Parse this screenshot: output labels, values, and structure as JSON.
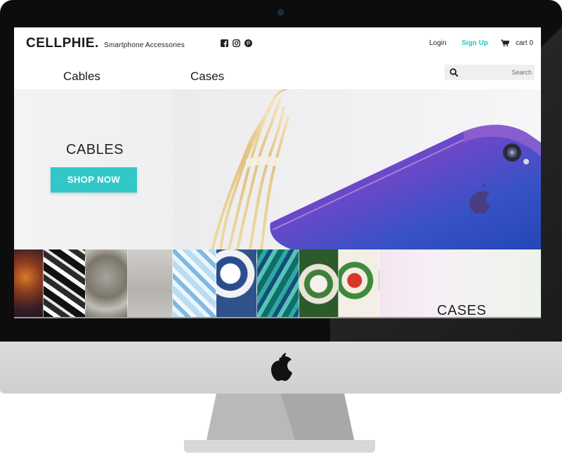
{
  "brand": {
    "logo": "CELLPHIE.",
    "tagline": "Smartphone Accessories"
  },
  "social_icons": [
    "facebook-icon",
    "instagram-icon",
    "pinterest-icon"
  ],
  "account": {
    "login": "Login",
    "signup": "Sign Up",
    "cart": "cart 0"
  },
  "nav": {
    "cables": "Cables",
    "cases": "Cases"
  },
  "search": {
    "placeholder": "Search",
    "icon": "search-icon"
  },
  "hero": {
    "title": "CABLES",
    "button": "SHOP NOW"
  },
  "cases_banner": {
    "title": "CASES"
  },
  "colors": {
    "accent": "#32c8c8",
    "signup": "#26c6c6",
    "text": "#1a1a1a",
    "phone_purple": "#7a3fbf",
    "phone_blue": "#2e4fc4"
  }
}
